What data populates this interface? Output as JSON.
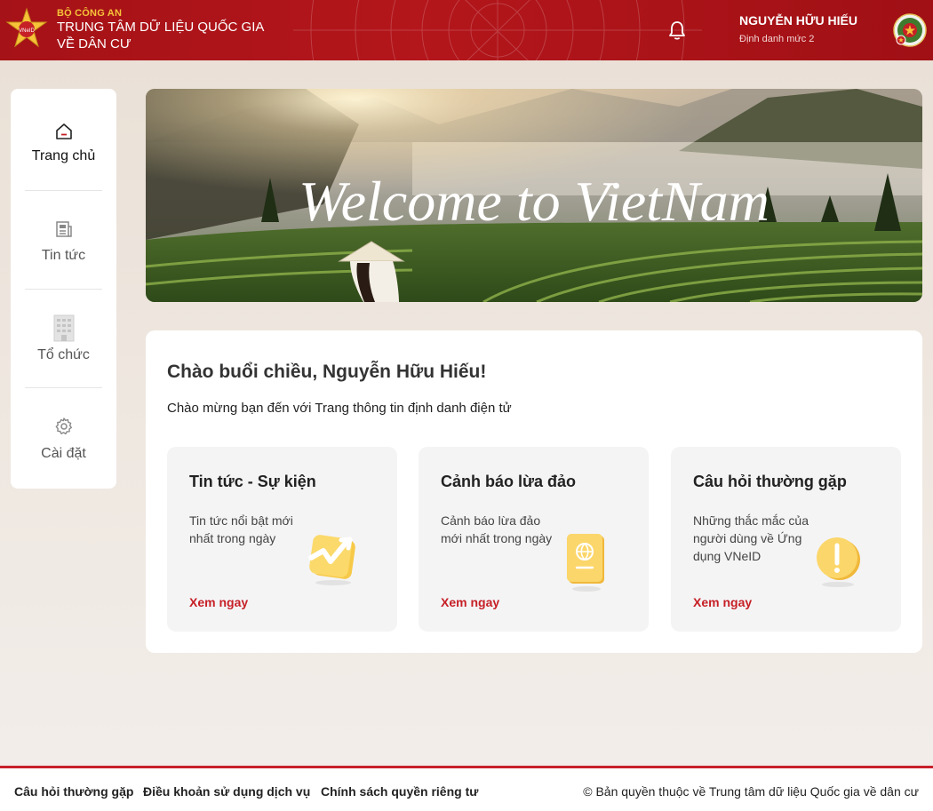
{
  "header": {
    "org_top": "BỘ CÔNG AN",
    "org_line1": "TRUNG TÂM DỮ LIỆU QUỐC GIA",
    "org_line2": "VỀ DÂN CƯ",
    "logo_text": "VNeID",
    "user_name": "NGUYỄN HỮU HIẾU",
    "user_level": "Định danh mức 2"
  },
  "sidebar": {
    "items": [
      {
        "label": "Trang chủ",
        "icon": "home-icon",
        "active": true
      },
      {
        "label": "Tin tức",
        "icon": "newspaper-icon",
        "active": false
      },
      {
        "label": "Tổ chức",
        "icon": "building-icon",
        "active": false
      },
      {
        "label": "Cài đặt",
        "icon": "gear-icon",
        "active": false
      }
    ]
  },
  "banner": {
    "text": "Welcome to VietNam"
  },
  "main": {
    "greeting": "Chào buổi chiều, Nguyễn Hữu Hiếu!",
    "welcome": "Chào mừng bạn đến với Trang thông tin định danh điện tử",
    "cards": [
      {
        "title": "Tin tức - Sự kiện",
        "desc": "Tin tức nổi bật mới nhất trong ngày",
        "link": "Xem ngay",
        "icon": "trend-chart-icon"
      },
      {
        "title": "Cảnh báo lừa đảo",
        "desc": "Cảnh báo lừa đảo mới nhất trong ngày",
        "link": "Xem ngay",
        "icon": "passport-icon"
      },
      {
        "title": "Câu hỏi thường gặp",
        "desc": "Những thắc mắc của người dùng về Ứng dụng VNeID",
        "link": "Xem ngay",
        "icon": "exclamation-icon"
      }
    ]
  },
  "footer": {
    "links": [
      "Câu hỏi thường gặp",
      "Điều khoản sử dụng dịch vụ",
      "Chính sách quyền riêng tư"
    ],
    "copyright": "© Bản quyền thuộc về Trung tâm dữ liệu Quốc gia về dân cư"
  },
  "colors": {
    "brand_red": "#b3161b",
    "gold": "#f6c338",
    "link_red": "#c62026"
  }
}
